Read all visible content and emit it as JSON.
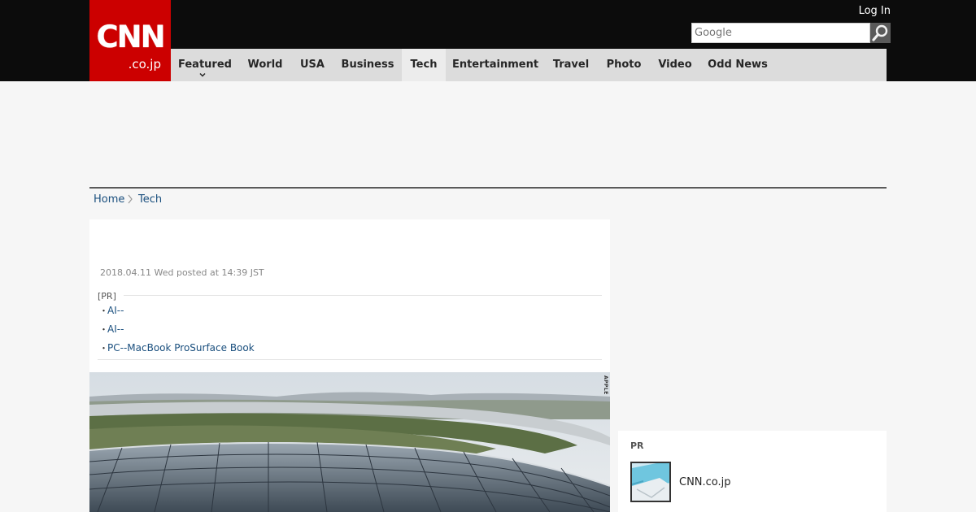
{
  "header": {
    "logo_text": "CNN",
    "logo_domain": ".co.jp",
    "login_label": "Log In",
    "search_placeholder": "Google"
  },
  "nav": {
    "items": [
      {
        "label": "Featured",
        "has_dropdown": true
      },
      {
        "label": "World"
      },
      {
        "label": "USA"
      },
      {
        "label": "Business"
      },
      {
        "label": "Tech",
        "active": true
      },
      {
        "label": "Entertainment"
      },
      {
        "label": "Travel"
      },
      {
        "label": "Photo"
      },
      {
        "label": "Video"
      },
      {
        "label": "Odd News"
      }
    ]
  },
  "breadcrumb": {
    "items": [
      "Home",
      "Tech"
    ]
  },
  "article": {
    "posted": "2018.04.11 Wed posted at 14:39 JST",
    "pr_label": "[PR]",
    "pr_links": [
      "AI--",
      "AI--",
      "PC--MacBook ProSurface Book"
    ],
    "photo_credit": "APPLE"
  },
  "sidebar": {
    "pr_title": "PR",
    "pr_item_text": "CNN.co.jp"
  },
  "colors": {
    "brand_red": "#cc0000",
    "topbar": "#0c0c0c",
    "nav_bg": "#dcdcdc",
    "link": "#1a4f7e"
  }
}
